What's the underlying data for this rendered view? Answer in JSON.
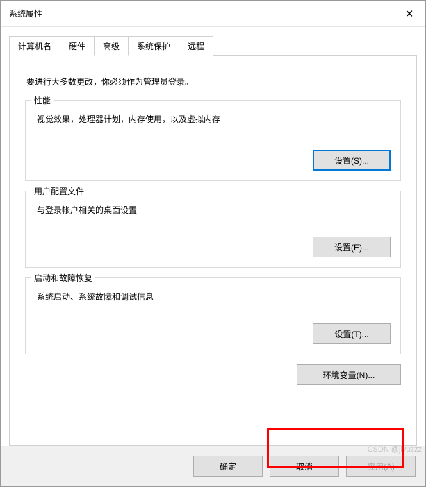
{
  "window": {
    "title": "系统属性",
    "close_symbol": "✕"
  },
  "tabs": {
    "t0": "计算机名",
    "t1": "硬件",
    "t2": "高级",
    "t3": "系统保护",
    "t4": "远程",
    "active_index": 2
  },
  "panel": {
    "intro": "要进行大多数更改，你必须作为管理员登录。",
    "groups": {
      "performance": {
        "title": "性能",
        "desc": "视觉效果，处理器计划，内存使用，以及虚拟内存",
        "button": "设置(S)..."
      },
      "userprofile": {
        "title": "用户配置文件",
        "desc": "与登录帐户相关的桌面设置",
        "button": "设置(E)..."
      },
      "startup": {
        "title": "启动和故障恢复",
        "desc": "系统启动、系统故障和调试信息",
        "button": "设置(T)..."
      }
    },
    "env_button": "环境变量(N)..."
  },
  "footer": {
    "ok": "确定",
    "cancel": "取消",
    "apply": "应用(A)"
  },
  "watermark": "CSDN @jiyuzzz"
}
